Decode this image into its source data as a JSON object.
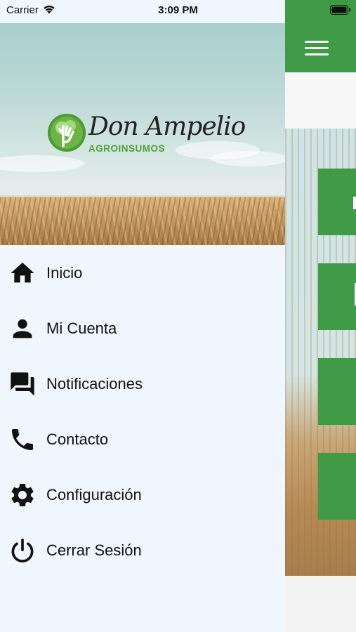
{
  "status_bar": {
    "carrier": "Carrier",
    "time": "3:09 PM"
  },
  "brand": {
    "name": "Don Ampelio",
    "subtitle": "AGROINSUMOS",
    "color_green": "#4aa23a",
    "color_dark": "#222222"
  },
  "menu": {
    "items": [
      {
        "label": "Inicio",
        "icon": "home-icon"
      },
      {
        "label": "Mi Cuenta",
        "icon": "person-icon"
      },
      {
        "label": "Notificaciones",
        "icon": "forum-icon"
      },
      {
        "label": "Contacto",
        "icon": "phone-icon"
      },
      {
        "label": "Configuración",
        "icon": "gear-icon"
      },
      {
        "label": "Cerrar Sesión",
        "icon": "power-icon"
      }
    ]
  },
  "colors": {
    "accent_green": "#3f9b46",
    "drawer_background": "#f0f6fd"
  }
}
